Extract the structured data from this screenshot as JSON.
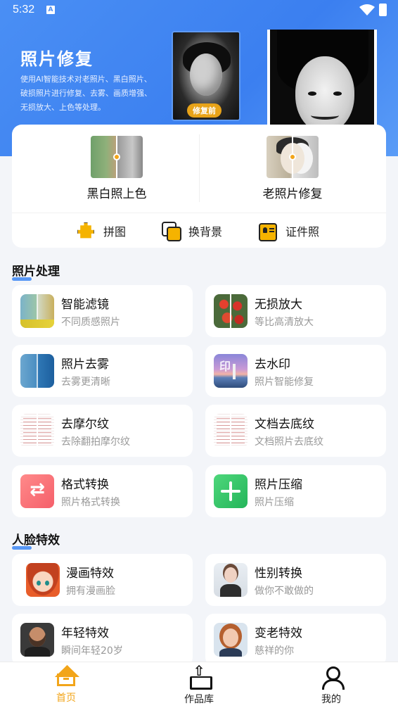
{
  "status_bar": {
    "time": "5:32",
    "notification_icon": "A"
  },
  "banner": {
    "title": "照片修复",
    "description": "使用AI智能技术对老照片、黑白照片、破损照片进行修复、去雾、画质增强、无损放大、上色等处理。",
    "before_tag": "修复前"
  },
  "main_features": [
    {
      "label": "黑白照上色",
      "icon": "bw-colorize-thumb"
    },
    {
      "label": "老照片修复",
      "icon": "old-photo-thumb"
    }
  ],
  "tools": [
    {
      "label": "拼图",
      "icon": "puzzle-icon"
    },
    {
      "label": "换背景",
      "icon": "layers-icon"
    },
    {
      "label": "证件照",
      "icon": "id-card-icon"
    }
  ],
  "photo_section": {
    "title": "照片处理",
    "items": [
      {
        "title": "智能滤镜",
        "subtitle": "不同质感照片",
        "icon": "filter-thumb"
      },
      {
        "title": "无损放大",
        "subtitle": "等比高清放大",
        "icon": "upscale-thumb"
      },
      {
        "title": "照片去雾",
        "subtitle": "去雾更清晰",
        "icon": "dehaze-thumb"
      },
      {
        "title": "去水印",
        "subtitle": "照片智能修复",
        "icon": "watermark-thumb"
      },
      {
        "title": "去摩尔纹",
        "subtitle": "去除翻拍摩尔纹",
        "icon": "moire-thumb"
      },
      {
        "title": "文档去底纹",
        "subtitle": "文档照片去底纹",
        "icon": "document-thumb"
      },
      {
        "title": "格式转换",
        "subtitle": "照片格式转换",
        "icon": "format-convert-icon"
      },
      {
        "title": "照片压缩",
        "subtitle": "照片压缩",
        "icon": "compress-icon"
      }
    ]
  },
  "face_section": {
    "title": "人脸特效",
    "items": [
      {
        "title": "漫画特效",
        "subtitle": "拥有漫画脸",
        "icon": "comic-thumb"
      },
      {
        "title": "性别转换",
        "subtitle": "做你不敢做的",
        "icon": "gender-thumb"
      },
      {
        "title": "年轻特效",
        "subtitle": "瞬间年轻20岁",
        "icon": "young-thumb"
      },
      {
        "title": "变老特效",
        "subtitle": "慈祥的你",
        "icon": "old-thumb"
      }
    ]
  },
  "bottom_nav": [
    {
      "label": "首页",
      "icon": "home-icon",
      "active": true
    },
    {
      "label": "作品库",
      "icon": "works-icon",
      "active": false
    },
    {
      "label": "我的",
      "icon": "profile-icon",
      "active": false
    }
  ],
  "colors": {
    "brand_blue": "#3b7ff0",
    "accent_orange": "#f2a51a",
    "background": "#f3f5f9"
  }
}
